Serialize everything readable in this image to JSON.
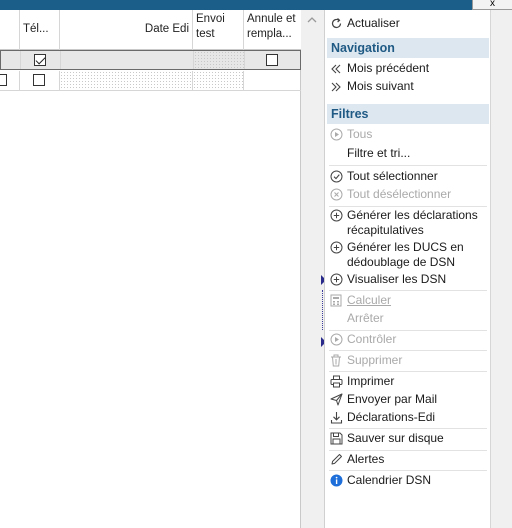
{
  "window": {
    "close_label": "x"
  },
  "grid": {
    "headers": {
      "tel": "Tél...",
      "date_edi": "Date Edi",
      "envoi_test": "Envoi test",
      "annule": "Annule et rempla..."
    },
    "rows": [
      {
        "tel_checked": true,
        "annule_checked": false
      },
      {
        "tel_checked": false
      }
    ]
  },
  "panel": {
    "refresh": "Actualiser",
    "navigation_title": "Navigation",
    "prev_month": "Mois précédent",
    "next_month": "Mois suivant",
    "filters_title": "Filtres",
    "all": "Tous",
    "filter_sort": "Filtre et tri...",
    "select_all": "Tout sélectionner",
    "deselect_all": "Tout désélectionner",
    "generate_summary": "Générer les déclarations récapitulatives",
    "generate_ducs": "Générer les DUCS en dédoublage de DSN",
    "view_dsn": "Visualiser les DSN",
    "calculate": "Calculer",
    "stop": "Arrêter",
    "check": "Contrôler",
    "delete": "Supprimer",
    "print": "Imprimer",
    "send_mail": "Envoyer par Mail",
    "declarations_edi": "Déclarations-Edi",
    "save_disk": "Sauver sur disque",
    "alerts": "Alertes",
    "dsn_calendar": "Calendrier DSN"
  }
}
